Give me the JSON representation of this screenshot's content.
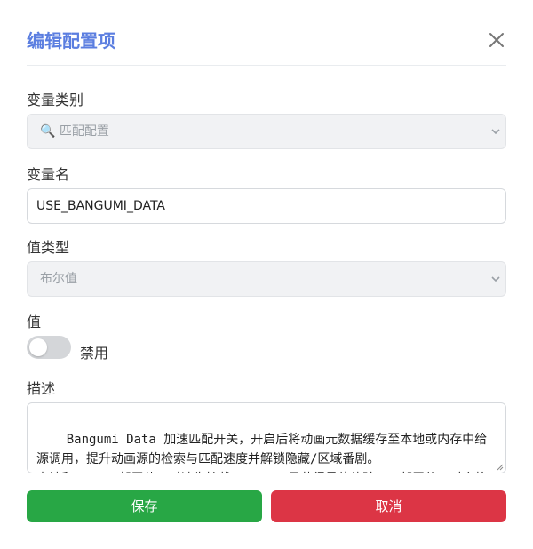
{
  "dialog": {
    "title": "编辑配置项"
  },
  "fields": {
    "category": {
      "label": "变量类别",
      "selected": "🔍 匹配配置"
    },
    "name": {
      "label": "变量名",
      "value": "USE_BANGUMI_DATA"
    },
    "value_type": {
      "label": "值类型",
      "selected": "布尔值"
    },
    "value": {
      "label": "值",
      "toggle_state": "禁用",
      "enabled": false
    },
    "description": {
      "label": "描述",
      "text": "Bangumi Data 加速匹配开关，开启后将动画元数据缓存至本地或内存中给源调用，提升动画源的检索与匹配速度并解锁隐藏/区域番剧。\n本地和Docker部署使用时请先挂载.cache目录获得最佳体验，云部署使用时会将数据缓存至内存中本身已使用的流量。"
    }
  },
  "actions": {
    "save_label": "保存",
    "cancel_label": "取消"
  },
  "colors": {
    "title": "#5b7ee0",
    "save": "#28a745",
    "cancel": "#dc3545",
    "toggle_off": "#d4d6d9"
  }
}
